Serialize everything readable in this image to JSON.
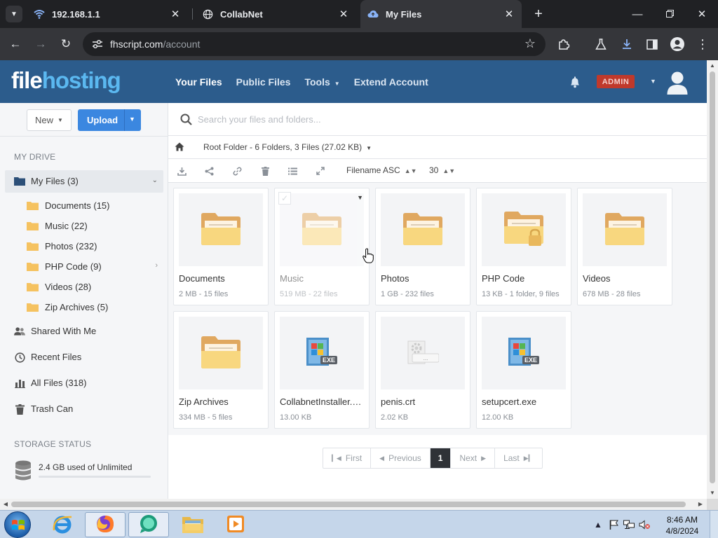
{
  "browser": {
    "tabs": [
      {
        "label": "192.168.1.1",
        "icon": "wifi-icon",
        "active": false
      },
      {
        "label": "CollabNet",
        "icon": "globe-icon",
        "active": false
      },
      {
        "label": "My Files",
        "icon": "cloud-icon",
        "active": true
      }
    ],
    "new_tab": "+",
    "url_host": "fhscript.com",
    "url_path": "/account"
  },
  "app": {
    "logo_part1": "file",
    "logo_part2": "hosting",
    "nav": [
      "Your Files",
      "Public Files",
      "Tools",
      "Extend Account"
    ],
    "admin_label": "ADMIN"
  },
  "sidebar": {
    "new_label": "New",
    "upload_label": "Upload",
    "my_drive_heading": "MY DRIVE",
    "my_files": "My Files (3)",
    "folders": [
      "Documents (15)",
      "Music (22)",
      "Photos (232)",
      "PHP Code (9)",
      "Videos (28)",
      "Zip Archives (5)"
    ],
    "items": [
      "Shared With Me",
      "Recent Files",
      "All Files (318)",
      "Trash Can"
    ],
    "storage_heading": "STORAGE STATUS",
    "storage_text": "2.4 GB used of Unlimited",
    "storage_used_fraction": 0
  },
  "content": {
    "search_placeholder": "Search your files and folders...",
    "breadcrumb": "Root Folder - 6 Folders, 3 Files (27.02 KB)",
    "sort_label": "Filename ASC",
    "per_page": "30",
    "items": [
      {
        "name": "Documents",
        "meta": "2 MB - 15 files",
        "kind": "folder"
      },
      {
        "name": "Music",
        "meta": "519 MB - 22 files",
        "kind": "folder"
      },
      {
        "name": "Photos",
        "meta": "1 GB - 232 files",
        "kind": "folder"
      },
      {
        "name": "PHP Code",
        "meta": "13 KB - 1 folder, 9 files",
        "kind": "folder-locked"
      },
      {
        "name": "Videos",
        "meta": "678 MB - 28 files",
        "kind": "folder"
      },
      {
        "name": "Zip Archives",
        "meta": "334 MB - 5 files",
        "kind": "folder"
      },
      {
        "name": "CollabnetInstaller.exe",
        "meta": "13.00 KB",
        "kind": "exe"
      },
      {
        "name": "penis.crt",
        "meta": "2.02 KB",
        "kind": "crt"
      },
      {
        "name": "setupcert.exe",
        "meta": "12.00 KB",
        "kind": "exe"
      }
    ],
    "pagination": {
      "first": "First",
      "previous": "Previous",
      "current": "1",
      "next": "Next",
      "last": "Last"
    }
  },
  "exe_label": "EXE",
  "taskbar": {
    "time": "8:46 AM",
    "date": "4/8/2024"
  },
  "colors": {
    "header_bg": "#2c5c8c",
    "logo_accent": "#5bb8f0",
    "upload_blue": "#3b87e0",
    "admin_red": "#c0392b",
    "folder_tan": "#e0a860",
    "folder_yellow": "#f8d77f"
  }
}
